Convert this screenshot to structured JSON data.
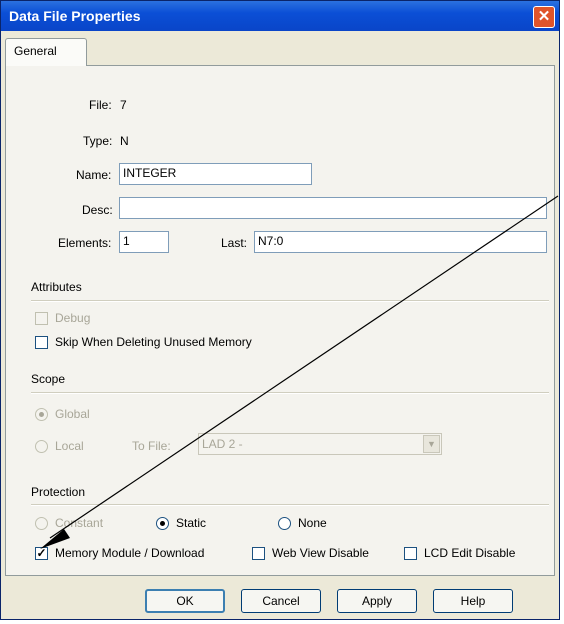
{
  "window": {
    "title": "Data File Properties",
    "close_glyph": "✕"
  },
  "tabs": [
    {
      "label": "General"
    }
  ],
  "fields": {
    "file_label": "File:",
    "file_value": "7",
    "type_label": "Type:",
    "type_value": "N",
    "name_label": "Name:",
    "name_value": "INTEGER",
    "desc_label": "Desc:",
    "desc_value": "",
    "elements_label": "Elements:",
    "elements_value": "1",
    "last_label": "Last:",
    "last_value": "N7:0"
  },
  "attributes": {
    "heading": "Attributes",
    "debug_label": "Debug",
    "debug_checked": false,
    "skip_label": "Skip When Deleting Unused Memory",
    "skip_checked": false
  },
  "scope": {
    "heading": "Scope",
    "global_label": "Global",
    "global_selected": true,
    "local_label": "Local",
    "local_selected": false,
    "tofile_label": "To File:",
    "tofile_value": "LAD 2 -"
  },
  "protection": {
    "heading": "Protection",
    "constant_label": "Constant",
    "static_label": "Static",
    "static_selected": true,
    "none_label": "None",
    "memory_label": "Memory Module / Download",
    "memory_checked": true,
    "webview_label": "Web View Disable",
    "webview_checked": false,
    "lcd_label": "LCD Edit Disable",
    "lcd_checked": false,
    "check_glyph": "✓"
  },
  "buttons": {
    "ok": "OK",
    "cancel": "Cancel",
    "apply": "Apply",
    "help": "Help"
  },
  "colors": {
    "title_bar": "#0b4fd6",
    "close": "#e0542a",
    "dialog_bg": "#ece9d8",
    "annotation_arrow": "#000000"
  }
}
